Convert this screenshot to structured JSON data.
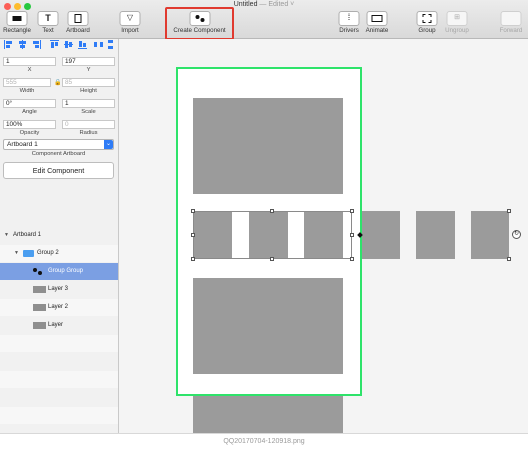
{
  "window": {
    "title": "Untitled",
    "status": " — Edited ˅",
    "traffic_lights": [
      "#fc5f57",
      "#fdbc2e",
      "#28c840"
    ]
  },
  "toolbar": {
    "rectangle": "Rectangle",
    "text": "Text",
    "text_icon": "T",
    "artboard": "Artboard",
    "import": "Import",
    "create_component": "Create Component",
    "drivers": "Drivers",
    "animate": "Animate",
    "group": "Group",
    "ungroup": "Ungroup",
    "forward": "Forward"
  },
  "inspector": {
    "x": {
      "value": "1",
      "label": "X"
    },
    "y": {
      "value": "197",
      "label": "Y"
    },
    "width": {
      "value": "555",
      "label": "Width"
    },
    "height": {
      "value": "85",
      "label": "Height"
    },
    "angle": {
      "value": "0°",
      "label": "Angle"
    },
    "scale": {
      "value": "1",
      "label": "Scale"
    },
    "opacity": {
      "value": "100%",
      "label": "Opacity"
    },
    "radius": {
      "value": "0",
      "label": "Radius"
    },
    "component_artboard": {
      "selected": "Artboard 1",
      "label": "Component Artboard"
    },
    "edit_component": "Edit Component"
  },
  "layers": [
    {
      "name": "Artboard 1"
    },
    {
      "name": "Group 2"
    },
    {
      "name": "Group Group"
    },
    {
      "name": "Layer 3"
    },
    {
      "name": "Layer 2"
    },
    {
      "name": "Layer"
    }
  ],
  "status_bar": "QQ20170704-120918.png",
  "colors": {
    "accent_red": "#e03a2f",
    "artboard_border": "#2ee36a",
    "selection": "#7b9fe3"
  }
}
